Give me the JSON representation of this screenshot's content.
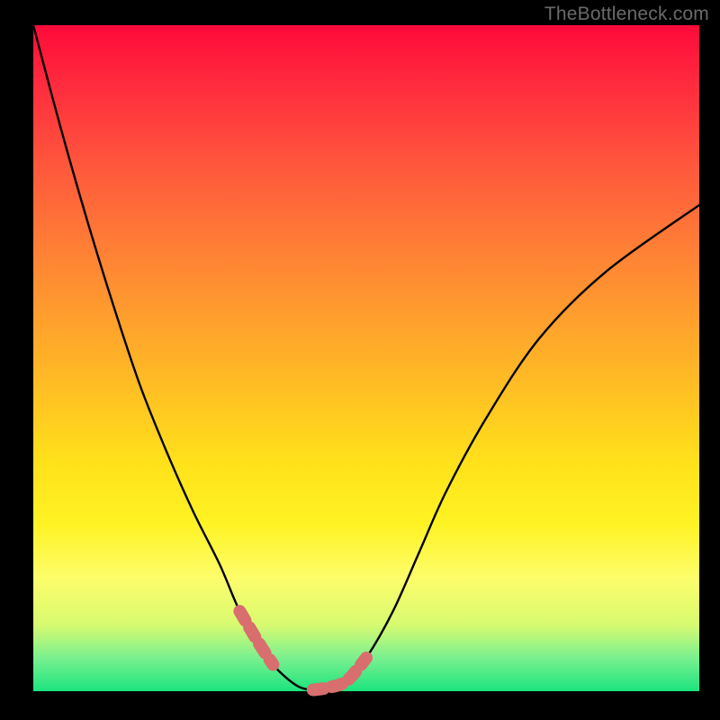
{
  "watermark": "TheBottleneck.com",
  "colors": {
    "frame": "#000000",
    "curve": "#000000",
    "highlight": "#d86e6e",
    "gradient_stops": [
      "#ff0a3a",
      "#ff2f3e",
      "#ff5a3c",
      "#ff8a33",
      "#ffb726",
      "#ffe21a",
      "#fff324",
      "#fdfd6b",
      "#d8fa70",
      "#7af08f",
      "#1be47e"
    ]
  },
  "chart_data": {
    "type": "line",
    "title": "",
    "xlabel": "",
    "ylabel": "",
    "xlim": [
      0,
      100
    ],
    "ylim": [
      0,
      100
    ],
    "series": [
      {
        "name": "curve",
        "x": [
          0,
          4,
          8,
          12,
          16,
          20,
          24,
          28,
          31,
          34,
          36,
          38,
          40,
          42,
          44,
          47,
          50,
          54,
          58,
          62,
          68,
          76,
          86,
          100
        ],
        "y": [
          100,
          85,
          71,
          58,
          46,
          36,
          27,
          19,
          12,
          7,
          4,
          2,
          0.6,
          0.2,
          0.5,
          1.5,
          5,
          12,
          21,
          30,
          41,
          53,
          63,
          73
        ]
      }
    ],
    "highlight_ranges_x": [
      [
        30,
        36
      ],
      [
        42,
        50
      ]
    ]
  }
}
